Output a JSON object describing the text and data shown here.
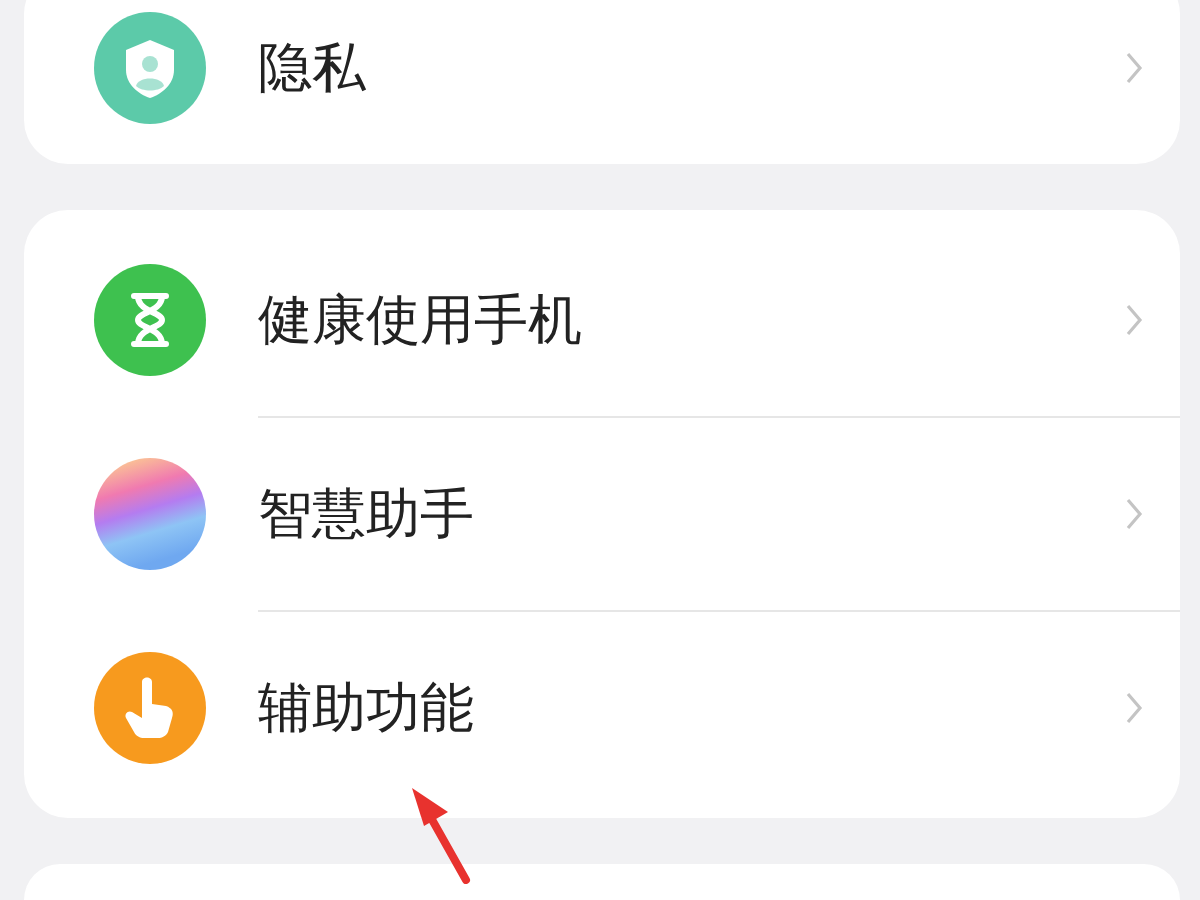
{
  "groups": [
    {
      "items": [
        {
          "label": "隐私"
        }
      ]
    },
    {
      "items": [
        {
          "label": "健康使用手机"
        },
        {
          "label": "智慧助手"
        },
        {
          "label": "辅助功能"
        }
      ]
    }
  ]
}
